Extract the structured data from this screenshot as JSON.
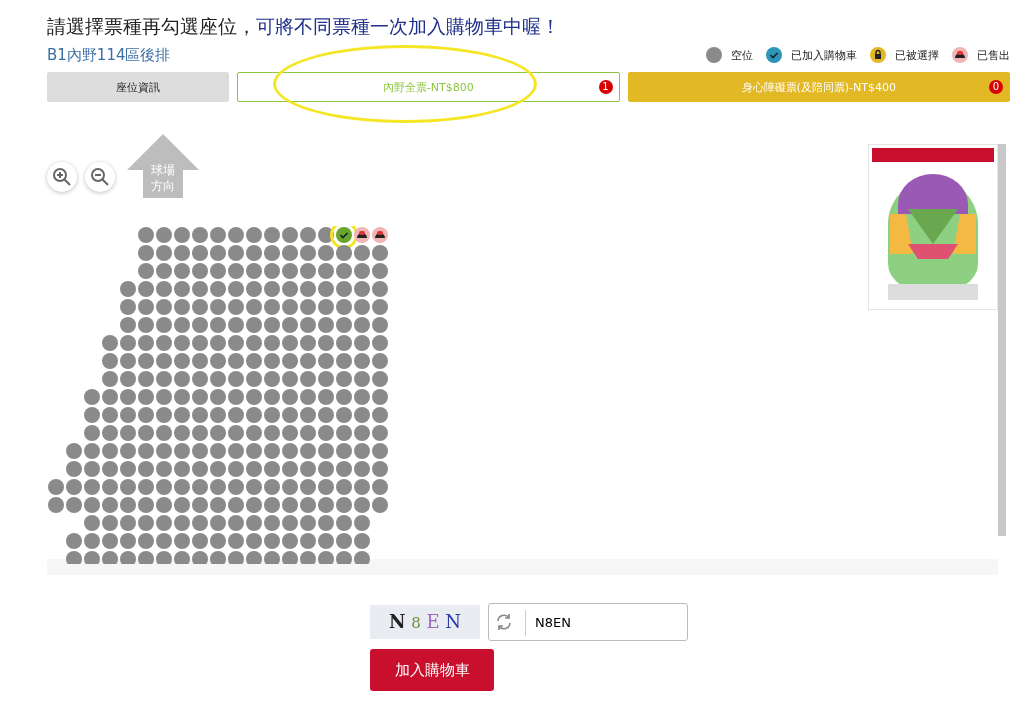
{
  "heading": {
    "main": "請選擇票種再勾選座位，",
    "emphasis": "可將不同票種一次加入購物車中喔！"
  },
  "area": "B1內野114區後排",
  "legend": [
    {
      "kind": "available",
      "label": "空位"
    },
    {
      "kind": "in_cart",
      "label": "已加入購物車"
    },
    {
      "kind": "locked",
      "label": "已被選擇"
    },
    {
      "kind": "sold",
      "label": "已售出"
    }
  ],
  "tabs": [
    {
      "kind": "info",
      "label": "座位資訊",
      "selected": false
    },
    {
      "kind": "ticket",
      "label": "內野全票-NT$800",
      "badge": "1",
      "color": "#8cc63f",
      "selected": true,
      "circled": true
    },
    {
      "kind": "ticket",
      "label": "身心障礙票(及陪同票)-NT$400",
      "badge": "0",
      "color": "#e2b824",
      "selected": false,
      "circled": false
    }
  ],
  "field_direction": "球場方向",
  "seat_rows": [
    [
      {
        "kind": "gap"
      },
      {
        "kind": "gap"
      },
      {
        "kind": "gap"
      },
      {
        "kind": "gap"
      },
      {
        "kind": "gap"
      },
      {
        "kind": "available"
      },
      {
        "kind": "available"
      },
      {
        "kind": "available"
      },
      {
        "kind": "available"
      },
      {
        "kind": "available"
      },
      {
        "kind": "available"
      },
      {
        "kind": "available"
      },
      {
        "kind": "available"
      },
      {
        "kind": "available"
      },
      {
        "kind": "available"
      },
      {
        "kind": "available"
      },
      {
        "kind": "chosen",
        "circled": true
      },
      {
        "kind": "sold"
      },
      {
        "kind": "sold"
      }
    ],
    [
      {
        "kind": "gap"
      },
      {
        "kind": "gap"
      },
      {
        "kind": "gap"
      },
      {
        "kind": "gap"
      },
      {
        "kind": "gap"
      },
      {
        "kind": "available"
      },
      {
        "kind": "available"
      },
      {
        "kind": "available"
      },
      {
        "kind": "available"
      },
      {
        "kind": "available"
      },
      {
        "kind": "available"
      },
      {
        "kind": "available"
      },
      {
        "kind": "available"
      },
      {
        "kind": "available"
      },
      {
        "kind": "available"
      },
      {
        "kind": "available"
      },
      {
        "kind": "available"
      },
      {
        "kind": "available"
      },
      {
        "kind": "available"
      }
    ],
    [
      {
        "kind": "gap"
      },
      {
        "kind": "gap"
      },
      {
        "kind": "gap"
      },
      {
        "kind": "gap"
      },
      {
        "kind": "gap"
      },
      {
        "kind": "available"
      },
      {
        "kind": "available"
      },
      {
        "kind": "available"
      },
      {
        "kind": "available"
      },
      {
        "kind": "available"
      },
      {
        "kind": "available"
      },
      {
        "kind": "available"
      },
      {
        "kind": "available"
      },
      {
        "kind": "available"
      },
      {
        "kind": "available"
      },
      {
        "kind": "available"
      },
      {
        "kind": "available"
      },
      {
        "kind": "available"
      },
      {
        "kind": "available"
      }
    ],
    [
      {
        "kind": "gap"
      },
      {
        "kind": "gap"
      },
      {
        "kind": "gap"
      },
      {
        "kind": "gap"
      },
      {
        "kind": "available"
      },
      {
        "kind": "available"
      },
      {
        "kind": "available"
      },
      {
        "kind": "available"
      },
      {
        "kind": "available"
      },
      {
        "kind": "available"
      },
      {
        "kind": "available"
      },
      {
        "kind": "available"
      },
      {
        "kind": "available"
      },
      {
        "kind": "available"
      },
      {
        "kind": "available"
      },
      {
        "kind": "available"
      },
      {
        "kind": "available"
      },
      {
        "kind": "available"
      },
      {
        "kind": "available"
      }
    ],
    [
      {
        "kind": "gap"
      },
      {
        "kind": "gap"
      },
      {
        "kind": "gap"
      },
      {
        "kind": "gap"
      },
      {
        "kind": "available"
      },
      {
        "kind": "available"
      },
      {
        "kind": "available"
      },
      {
        "kind": "available"
      },
      {
        "kind": "available"
      },
      {
        "kind": "available"
      },
      {
        "kind": "available"
      },
      {
        "kind": "available"
      },
      {
        "kind": "available"
      },
      {
        "kind": "available"
      },
      {
        "kind": "available"
      },
      {
        "kind": "available"
      },
      {
        "kind": "available"
      },
      {
        "kind": "available"
      },
      {
        "kind": "available"
      }
    ],
    [
      {
        "kind": "gap"
      },
      {
        "kind": "gap"
      },
      {
        "kind": "gap"
      },
      {
        "kind": "gap"
      },
      {
        "kind": "available"
      },
      {
        "kind": "available"
      },
      {
        "kind": "available"
      },
      {
        "kind": "available"
      },
      {
        "kind": "available"
      },
      {
        "kind": "available"
      },
      {
        "kind": "available"
      },
      {
        "kind": "available"
      },
      {
        "kind": "available"
      },
      {
        "kind": "available"
      },
      {
        "kind": "available"
      },
      {
        "kind": "available"
      },
      {
        "kind": "available"
      },
      {
        "kind": "available"
      },
      {
        "kind": "available"
      }
    ],
    [
      {
        "kind": "gap"
      },
      {
        "kind": "gap"
      },
      {
        "kind": "gap"
      },
      {
        "kind": "available"
      },
      {
        "kind": "available"
      },
      {
        "kind": "available"
      },
      {
        "kind": "available"
      },
      {
        "kind": "available"
      },
      {
        "kind": "available"
      },
      {
        "kind": "available"
      },
      {
        "kind": "available"
      },
      {
        "kind": "available"
      },
      {
        "kind": "available"
      },
      {
        "kind": "available"
      },
      {
        "kind": "available"
      },
      {
        "kind": "available"
      },
      {
        "kind": "available"
      },
      {
        "kind": "available"
      },
      {
        "kind": "available"
      }
    ],
    [
      {
        "kind": "gap"
      },
      {
        "kind": "gap"
      },
      {
        "kind": "gap"
      },
      {
        "kind": "available"
      },
      {
        "kind": "available"
      },
      {
        "kind": "available"
      },
      {
        "kind": "available"
      },
      {
        "kind": "available"
      },
      {
        "kind": "available"
      },
      {
        "kind": "available"
      },
      {
        "kind": "available"
      },
      {
        "kind": "available"
      },
      {
        "kind": "available"
      },
      {
        "kind": "available"
      },
      {
        "kind": "available"
      },
      {
        "kind": "available"
      },
      {
        "kind": "available"
      },
      {
        "kind": "available"
      },
      {
        "kind": "available"
      }
    ],
    [
      {
        "kind": "gap"
      },
      {
        "kind": "gap"
      },
      {
        "kind": "gap"
      },
      {
        "kind": "available"
      },
      {
        "kind": "available"
      },
      {
        "kind": "available"
      },
      {
        "kind": "available"
      },
      {
        "kind": "available"
      },
      {
        "kind": "available"
      },
      {
        "kind": "available"
      },
      {
        "kind": "available"
      },
      {
        "kind": "available"
      },
      {
        "kind": "available"
      },
      {
        "kind": "available"
      },
      {
        "kind": "available"
      },
      {
        "kind": "available"
      },
      {
        "kind": "available"
      },
      {
        "kind": "available"
      },
      {
        "kind": "available"
      }
    ],
    [
      {
        "kind": "gap"
      },
      {
        "kind": "gap"
      },
      {
        "kind": "available"
      },
      {
        "kind": "available"
      },
      {
        "kind": "available"
      },
      {
        "kind": "available"
      },
      {
        "kind": "available"
      },
      {
        "kind": "available"
      },
      {
        "kind": "available"
      },
      {
        "kind": "available"
      },
      {
        "kind": "available"
      },
      {
        "kind": "available"
      },
      {
        "kind": "available"
      },
      {
        "kind": "available"
      },
      {
        "kind": "available"
      },
      {
        "kind": "available"
      },
      {
        "kind": "available"
      },
      {
        "kind": "available"
      },
      {
        "kind": "available"
      }
    ],
    [
      {
        "kind": "gap"
      },
      {
        "kind": "gap"
      },
      {
        "kind": "available"
      },
      {
        "kind": "available"
      },
      {
        "kind": "available"
      },
      {
        "kind": "available"
      },
      {
        "kind": "available"
      },
      {
        "kind": "available"
      },
      {
        "kind": "available"
      },
      {
        "kind": "available"
      },
      {
        "kind": "available"
      },
      {
        "kind": "available"
      },
      {
        "kind": "available"
      },
      {
        "kind": "available"
      },
      {
        "kind": "available"
      },
      {
        "kind": "available"
      },
      {
        "kind": "available"
      },
      {
        "kind": "available"
      },
      {
        "kind": "available"
      }
    ],
    [
      {
        "kind": "gap"
      },
      {
        "kind": "gap"
      },
      {
        "kind": "available"
      },
      {
        "kind": "available"
      },
      {
        "kind": "available"
      },
      {
        "kind": "available"
      },
      {
        "kind": "available"
      },
      {
        "kind": "available"
      },
      {
        "kind": "available"
      },
      {
        "kind": "available"
      },
      {
        "kind": "available"
      },
      {
        "kind": "available"
      },
      {
        "kind": "available"
      },
      {
        "kind": "available"
      },
      {
        "kind": "available"
      },
      {
        "kind": "available"
      },
      {
        "kind": "available"
      },
      {
        "kind": "available"
      },
      {
        "kind": "available"
      }
    ],
    [
      {
        "kind": "gap"
      },
      {
        "kind": "available"
      },
      {
        "kind": "available"
      },
      {
        "kind": "available"
      },
      {
        "kind": "available"
      },
      {
        "kind": "available"
      },
      {
        "kind": "available"
      },
      {
        "kind": "available"
      },
      {
        "kind": "available"
      },
      {
        "kind": "available"
      },
      {
        "kind": "available"
      },
      {
        "kind": "available"
      },
      {
        "kind": "available"
      },
      {
        "kind": "available"
      },
      {
        "kind": "available"
      },
      {
        "kind": "available"
      },
      {
        "kind": "available"
      },
      {
        "kind": "available"
      },
      {
        "kind": "available"
      }
    ],
    [
      {
        "kind": "gap"
      },
      {
        "kind": "available"
      },
      {
        "kind": "available"
      },
      {
        "kind": "available"
      },
      {
        "kind": "available"
      },
      {
        "kind": "available"
      },
      {
        "kind": "available"
      },
      {
        "kind": "available"
      },
      {
        "kind": "available"
      },
      {
        "kind": "available"
      },
      {
        "kind": "available"
      },
      {
        "kind": "available"
      },
      {
        "kind": "available"
      },
      {
        "kind": "available"
      },
      {
        "kind": "available"
      },
      {
        "kind": "available"
      },
      {
        "kind": "available"
      },
      {
        "kind": "available"
      },
      {
        "kind": "available"
      }
    ],
    [
      {
        "kind": "available"
      },
      {
        "kind": "available"
      },
      {
        "kind": "available"
      },
      {
        "kind": "available"
      },
      {
        "kind": "available"
      },
      {
        "kind": "available"
      },
      {
        "kind": "available"
      },
      {
        "kind": "available"
      },
      {
        "kind": "available"
      },
      {
        "kind": "available"
      },
      {
        "kind": "available"
      },
      {
        "kind": "available"
      },
      {
        "kind": "available"
      },
      {
        "kind": "available"
      },
      {
        "kind": "available"
      },
      {
        "kind": "available"
      },
      {
        "kind": "available"
      },
      {
        "kind": "available"
      },
      {
        "kind": "available"
      }
    ],
    [
      {
        "kind": "available"
      },
      {
        "kind": "available"
      },
      {
        "kind": "available"
      },
      {
        "kind": "available"
      },
      {
        "kind": "available"
      },
      {
        "kind": "available"
      },
      {
        "kind": "available"
      },
      {
        "kind": "available"
      },
      {
        "kind": "available"
      },
      {
        "kind": "available"
      },
      {
        "kind": "available"
      },
      {
        "kind": "available"
      },
      {
        "kind": "available"
      },
      {
        "kind": "available"
      },
      {
        "kind": "available"
      },
      {
        "kind": "available"
      },
      {
        "kind": "available"
      },
      {
        "kind": "available"
      },
      {
        "kind": "available"
      }
    ],
    [
      {
        "kind": "gap"
      },
      {
        "kind": "gap"
      },
      {
        "kind": "available"
      },
      {
        "kind": "available"
      },
      {
        "kind": "available"
      },
      {
        "kind": "available"
      },
      {
        "kind": "available"
      },
      {
        "kind": "available"
      },
      {
        "kind": "available"
      },
      {
        "kind": "available"
      },
      {
        "kind": "available"
      },
      {
        "kind": "available"
      },
      {
        "kind": "available"
      },
      {
        "kind": "available"
      },
      {
        "kind": "available"
      },
      {
        "kind": "available"
      },
      {
        "kind": "available"
      },
      {
        "kind": "available"
      },
      {
        "kind": "gap"
      }
    ],
    [
      {
        "kind": "gap"
      },
      {
        "kind": "available"
      },
      {
        "kind": "available"
      },
      {
        "kind": "available"
      },
      {
        "kind": "available"
      },
      {
        "kind": "available"
      },
      {
        "kind": "available"
      },
      {
        "kind": "available"
      },
      {
        "kind": "available"
      },
      {
        "kind": "available"
      },
      {
        "kind": "available"
      },
      {
        "kind": "available"
      },
      {
        "kind": "available"
      },
      {
        "kind": "available"
      },
      {
        "kind": "available"
      },
      {
        "kind": "available"
      },
      {
        "kind": "available"
      },
      {
        "kind": "available"
      },
      {
        "kind": "gap"
      }
    ],
    [
      {
        "kind": "gap"
      },
      {
        "kind": "available"
      },
      {
        "kind": "available"
      },
      {
        "kind": "available"
      },
      {
        "kind": "available"
      },
      {
        "kind": "available"
      },
      {
        "kind": "available"
      },
      {
        "kind": "available"
      },
      {
        "kind": "available"
      },
      {
        "kind": "available"
      },
      {
        "kind": "available"
      },
      {
        "kind": "available"
      },
      {
        "kind": "available"
      },
      {
        "kind": "available"
      },
      {
        "kind": "available"
      },
      {
        "kind": "available"
      },
      {
        "kind": "available"
      },
      {
        "kind": "available"
      },
      {
        "kind": "gap"
      }
    ]
  ],
  "captcha": {
    "text": "N 8 E N",
    "value": "N8EN"
  },
  "submit": "加入購物車"
}
